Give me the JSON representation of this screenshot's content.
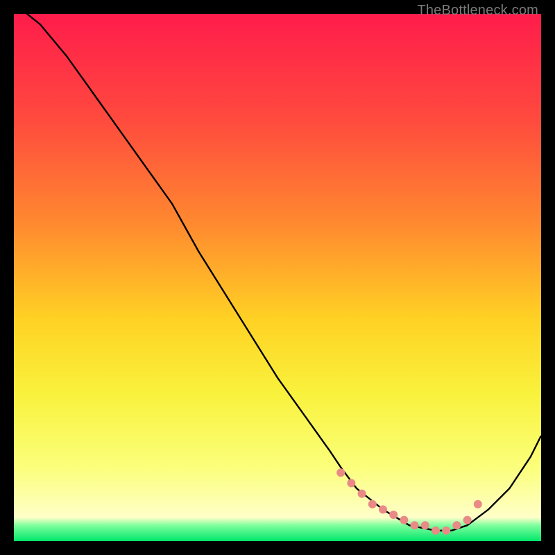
{
  "watermark": "TheBottleneck.com",
  "chart_data": {
    "type": "line",
    "title": "",
    "xlabel": "",
    "ylabel": "",
    "xlim": [
      0,
      100
    ],
    "ylim": [
      0,
      100
    ],
    "background_gradient": {
      "stops": [
        {
          "pos": 0.0,
          "color": "#ff1c4b"
        },
        {
          "pos": 0.2,
          "color": "#ff4a3e"
        },
        {
          "pos": 0.4,
          "color": "#ff8a2f"
        },
        {
          "pos": 0.58,
          "color": "#ffd224"
        },
        {
          "pos": 0.72,
          "color": "#f9f23c"
        },
        {
          "pos": 0.86,
          "color": "#fbff7b"
        },
        {
          "pos": 0.955,
          "color": "#ffffc8"
        },
        {
          "pos": 0.97,
          "color": "#7fff9e"
        },
        {
          "pos": 1.0,
          "color": "#00e66a"
        }
      ]
    },
    "series": [
      {
        "name": "bottleneck-curve",
        "x": [
          0,
          5,
          10,
          15,
          20,
          25,
          30,
          35,
          40,
          45,
          50,
          55,
          60,
          62,
          65,
          70,
          75,
          80,
          83,
          86,
          90,
          94,
          98,
          100
        ],
        "y": [
          102,
          98,
          92,
          85,
          78,
          71,
          64,
          55,
          47,
          39,
          31,
          24,
          17,
          14,
          10,
          6,
          3,
          2,
          2,
          3,
          6,
          10,
          16,
          20
        ]
      }
    ],
    "markers": {
      "name": "dots",
      "color": "#e98a86",
      "x": [
        62,
        64,
        66,
        68,
        70,
        72,
        74,
        76,
        78,
        80,
        82,
        84,
        86,
        88
      ],
      "y": [
        13,
        11,
        9,
        7,
        6,
        5,
        4,
        3,
        3,
        2,
        2,
        3,
        4,
        7
      ]
    }
  }
}
